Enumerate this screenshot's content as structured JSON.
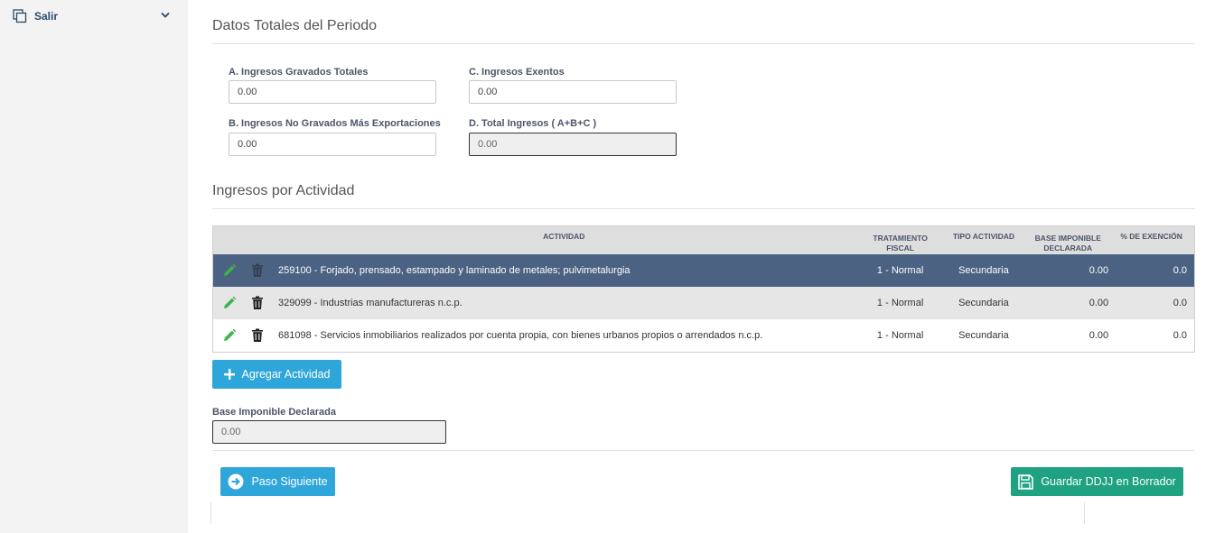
{
  "sidebar": {
    "item_label": "Salir",
    "item_icon": "copy-icon",
    "chevron_icon": "chevron-down-icon"
  },
  "totals": {
    "title": "Datos Totales del Periodo",
    "a_label": "A. Ingresos Gravados Totales",
    "a_value": "0.00",
    "b_label": "B. Ingresos No Gravados Más Exportaciones",
    "b_value": "0.00",
    "c_label": "C. Ingresos Exentos",
    "c_value": "0.00",
    "d_label": "D. Total Ingresos ( A+B+C )",
    "d_value": "0.00"
  },
  "activities": {
    "title": "Ingresos por Actividad",
    "headers": {
      "actividad": "ACTIVIDAD",
      "tratamiento_l1": "TRATAMIENTO",
      "tratamiento_l2": "FISCAL",
      "tipo": "TIPO ACTIVIDAD",
      "base_l1": "BASE IMPONIBLE",
      "base_l2": "DECLARADA",
      "exencion": "% DE EXENCIÓN"
    },
    "rows": [
      {
        "actividad": "259100 - Forjado, prensado, estampado y laminado de metales; pulvimetalurgia",
        "tratamiento": "1 - Normal",
        "tipo": "Secundaria",
        "base": "0.00",
        "exencion": "0.0"
      },
      {
        "actividad": "329099 - Industrias manufactureras n.c.p.",
        "tratamiento": "1 - Normal",
        "tipo": "Secundaria",
        "base": "0.00",
        "exencion": "0.0"
      },
      {
        "actividad": "681098 - Servicios inmobiliarios realizados por cuenta propia, con bienes urbanos propios o arrendados n.c.p.",
        "tratamiento": "1 - Normal",
        "tipo": "Secundaria",
        "base": "0.00",
        "exencion": "0.0"
      }
    ],
    "add_button": "Agregar Actividad"
  },
  "base": {
    "label": "Base Imponible Declarada",
    "value": "0.00"
  },
  "actions": {
    "next_label": "Paso Siguiente",
    "save_label": "Guardar DDJJ en Borrador"
  },
  "colors": {
    "accent_blue": "#2fa6d9",
    "accent_green": "#1ea282",
    "selected_row": "#4b6282",
    "edit_icon": "#3cb54a"
  }
}
